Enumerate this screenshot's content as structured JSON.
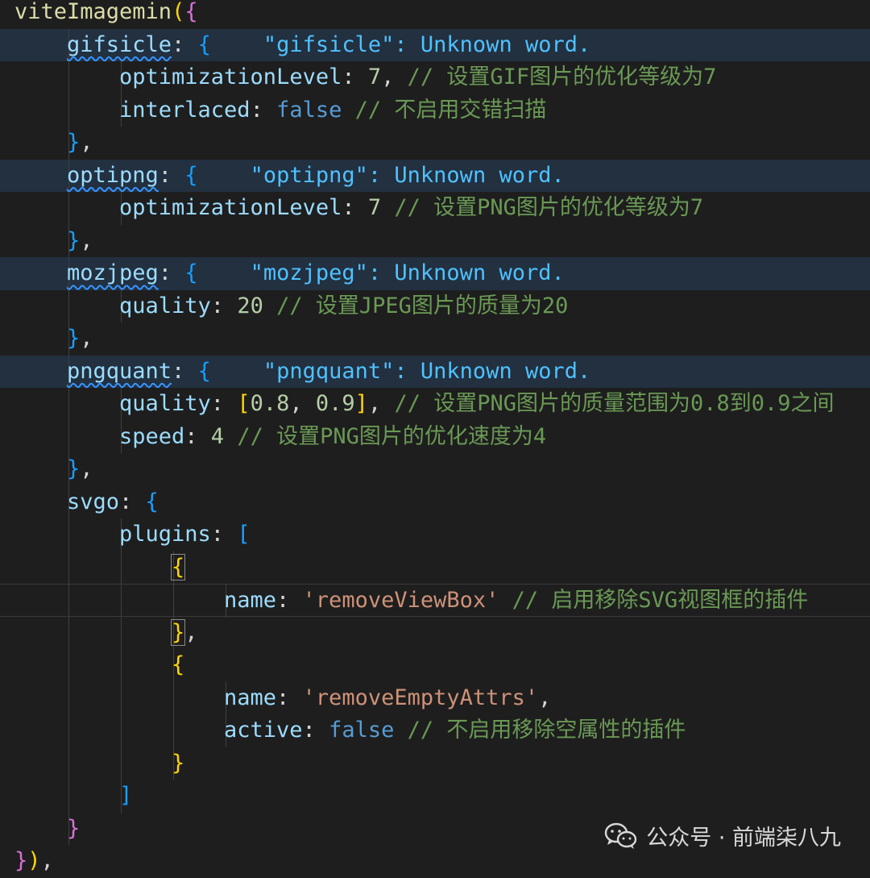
{
  "code": {
    "lines": [
      {
        "indent": 0,
        "tokens": [
          [
            "viteImagemin",
            "func"
          ],
          [
            "(",
            "b1"
          ],
          [
            "{",
            "b2"
          ]
        ]
      },
      {
        "indent": 1,
        "highlight": true,
        "tokens": [
          [
            "gifsicle",
            "prop",
            "squig"
          ],
          [
            ": ",
            "p"
          ],
          [
            "{",
            "b3"
          ],
          [
            "    \"gifsicle\": Unknown word.",
            "ghost"
          ]
        ]
      },
      {
        "indent": 2,
        "tokens": [
          [
            "optimizationLevel",
            "prop"
          ],
          [
            ": ",
            "p"
          ],
          [
            "7",
            "num"
          ],
          [
            ", ",
            "p"
          ],
          [
            "// 设置GIF图片的优化等级为7",
            "com"
          ]
        ]
      },
      {
        "indent": 2,
        "tokens": [
          [
            "interlaced",
            "prop"
          ],
          [
            ": ",
            "p"
          ],
          [
            "false",
            "kw"
          ],
          [
            " ",
            "p"
          ],
          [
            "// 不启用交错扫描",
            "com"
          ]
        ]
      },
      {
        "indent": 1,
        "tokens": [
          [
            "}",
            "b3"
          ],
          [
            ",",
            "p"
          ]
        ]
      },
      {
        "indent": 1,
        "highlight": true,
        "tokens": [
          [
            "optipng",
            "prop",
            "squig"
          ],
          [
            ": ",
            "p"
          ],
          [
            "{",
            "b3"
          ],
          [
            "    \"optipng\": Unknown word.",
            "ghost"
          ]
        ]
      },
      {
        "indent": 2,
        "tokens": [
          [
            "optimizationLevel",
            "prop"
          ],
          [
            ": ",
            "p"
          ],
          [
            "7",
            "num"
          ],
          [
            " ",
            "p"
          ],
          [
            "// 设置PNG图片的优化等级为7",
            "com"
          ]
        ]
      },
      {
        "indent": 1,
        "tokens": [
          [
            "}",
            "b3"
          ],
          [
            ",",
            "p"
          ]
        ]
      },
      {
        "indent": 1,
        "highlight": true,
        "tokens": [
          [
            "mozjpeg",
            "prop",
            "squig"
          ],
          [
            ": ",
            "p"
          ],
          [
            "{",
            "b3"
          ],
          [
            "    \"mozjpeg\": Unknown word.",
            "ghost"
          ]
        ]
      },
      {
        "indent": 2,
        "tokens": [
          [
            "quality",
            "prop"
          ],
          [
            ": ",
            "p"
          ],
          [
            "20",
            "num"
          ],
          [
            " ",
            "p"
          ],
          [
            "// 设置JPEG图片的质量为20",
            "com"
          ]
        ]
      },
      {
        "indent": 1,
        "tokens": [
          [
            "}",
            "b3"
          ],
          [
            ",",
            "p"
          ]
        ]
      },
      {
        "indent": 1,
        "highlight": true,
        "tokens": [
          [
            "pngquant",
            "prop",
            "squig"
          ],
          [
            ": ",
            "p"
          ],
          [
            "{",
            "b3"
          ],
          [
            "    \"pngquant\": Unknown word.",
            "ghost"
          ]
        ]
      },
      {
        "indent": 2,
        "tokens": [
          [
            "quality",
            "prop"
          ],
          [
            ": ",
            "p"
          ],
          [
            "[",
            "b1"
          ],
          [
            "0.8",
            "num"
          ],
          [
            ", ",
            "p"
          ],
          [
            "0.9",
            "num"
          ],
          [
            "]",
            "b1"
          ],
          [
            ", ",
            "p"
          ],
          [
            "// 设置PNG图片的质量范围为0.8到0.9之间",
            "com"
          ]
        ]
      },
      {
        "indent": 2,
        "tokens": [
          [
            "speed",
            "prop"
          ],
          [
            ": ",
            "p"
          ],
          [
            "4",
            "num"
          ],
          [
            " ",
            "p"
          ],
          [
            "// 设置PNG图片的优化速度为4",
            "com"
          ]
        ]
      },
      {
        "indent": 1,
        "tokens": [
          [
            "}",
            "b3"
          ],
          [
            ",",
            "p"
          ]
        ]
      },
      {
        "indent": 1,
        "tokens": [
          [
            "svgo",
            "prop"
          ],
          [
            ": ",
            "p"
          ],
          [
            "{",
            "b3"
          ]
        ]
      },
      {
        "indent": 2,
        "tokens": [
          [
            "plugins",
            "prop"
          ],
          [
            ": ",
            "p"
          ],
          [
            "[",
            "b3"
          ]
        ]
      },
      {
        "indent": 3,
        "tokens": [
          [
            "{",
            "b1",
            "boxed"
          ]
        ]
      },
      {
        "indent": 4,
        "cursorLine": true,
        "tokens": [
          [
            "name",
            "prop"
          ],
          [
            ": ",
            "p"
          ],
          [
            "'removeViewBox'",
            "str"
          ],
          [
            " ",
            "p"
          ],
          [
            "// 启用移除SVG视图框的插件",
            "com"
          ]
        ]
      },
      {
        "indent": 3,
        "tokens": [
          [
            "}",
            "b1",
            "boxed"
          ],
          [
            ",",
            "p"
          ]
        ]
      },
      {
        "indent": 3,
        "tokens": [
          [
            "{",
            "b1"
          ]
        ]
      },
      {
        "indent": 4,
        "tokens": [
          [
            "name",
            "prop"
          ],
          [
            ": ",
            "p"
          ],
          [
            "'removeEmptyAttrs'",
            "str"
          ],
          [
            ",",
            "p"
          ]
        ]
      },
      {
        "indent": 4,
        "tokens": [
          [
            "active",
            "prop"
          ],
          [
            ": ",
            "p"
          ],
          [
            "false",
            "kw"
          ],
          [
            " ",
            "p"
          ],
          [
            "// 不启用移除空属性的插件",
            "com"
          ]
        ]
      },
      {
        "indent": 3,
        "tokens": [
          [
            "}",
            "b1"
          ]
        ]
      },
      {
        "indent": 2,
        "tokens": [
          [
            "]",
            "b3"
          ]
        ]
      },
      {
        "indent": 1,
        "tokens": [
          [
            "}",
            "b2"
          ]
        ]
      },
      {
        "indent": 0,
        "tokens": [
          [
            "}",
            "b2"
          ],
          [
            ")",
            "b1"
          ],
          [
            ",",
            "p"
          ]
        ]
      }
    ]
  },
  "watermark": {
    "icon": "wechat-icon",
    "text": "公众号 · 前端柒八九"
  }
}
